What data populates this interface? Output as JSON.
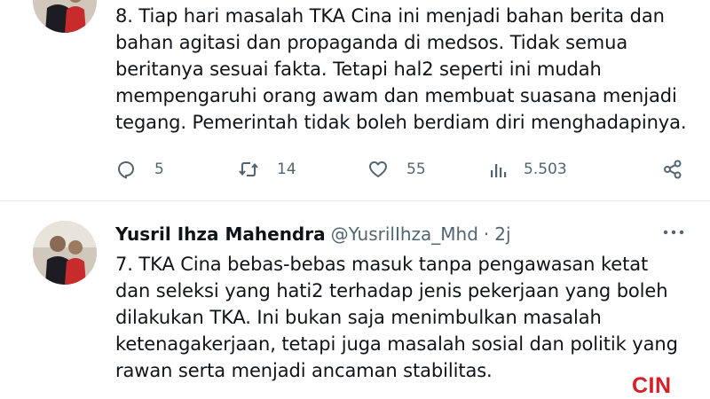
{
  "tweets": [
    {
      "text_lines": [
        "8. Tiap hari masalah TKA Cina ini menjadi bahan berita dan",
        "bahan agitasi dan propaganda di medsos. Tidak semua",
        "beritanya sesuai fakta. Tetapi hal2 seperti ini mudah",
        "mempengaruhi orang awam dan membuat suasana menjadi",
        "tegang. Pemerintah tidak boleh berdiam diri menghadapinya."
      ],
      "actions": {
        "reply_icon": "reply-icon",
        "replies": "5",
        "retweet_icon": "retweet-icon",
        "retweets": "14",
        "like_icon": "heart-icon",
        "likes": "55",
        "views_icon": "views-icon",
        "views": "5.503",
        "share_icon": "share-icon"
      }
    },
    {
      "author": {
        "name": "Yusril Ihza Mahendra",
        "handle": "@YusrilIhza_Mhd",
        "separator": "·",
        "time": "2j"
      },
      "more_icon": "more-icon",
      "text_lines": [
        "7. TKA Cina bebas-bebas masuk tanpa pengawasan ketat",
        "dan seleksi yang hati2 terhadap jenis pekerjaan yang boleh",
        "dilakukan TKA. Ini bukan saja menimbulkan masalah",
        "ketenagakerjaan, tetapi juga masalah sosial dan politik yang",
        "rawan serta menjadi ancaman stabilitas."
      ]
    }
  ],
  "watermark": "CIN",
  "colors": {
    "text": "#0f1419",
    "secondary": "#536471",
    "divider": "#e3e8ec",
    "watermark": "#d71f26"
  }
}
